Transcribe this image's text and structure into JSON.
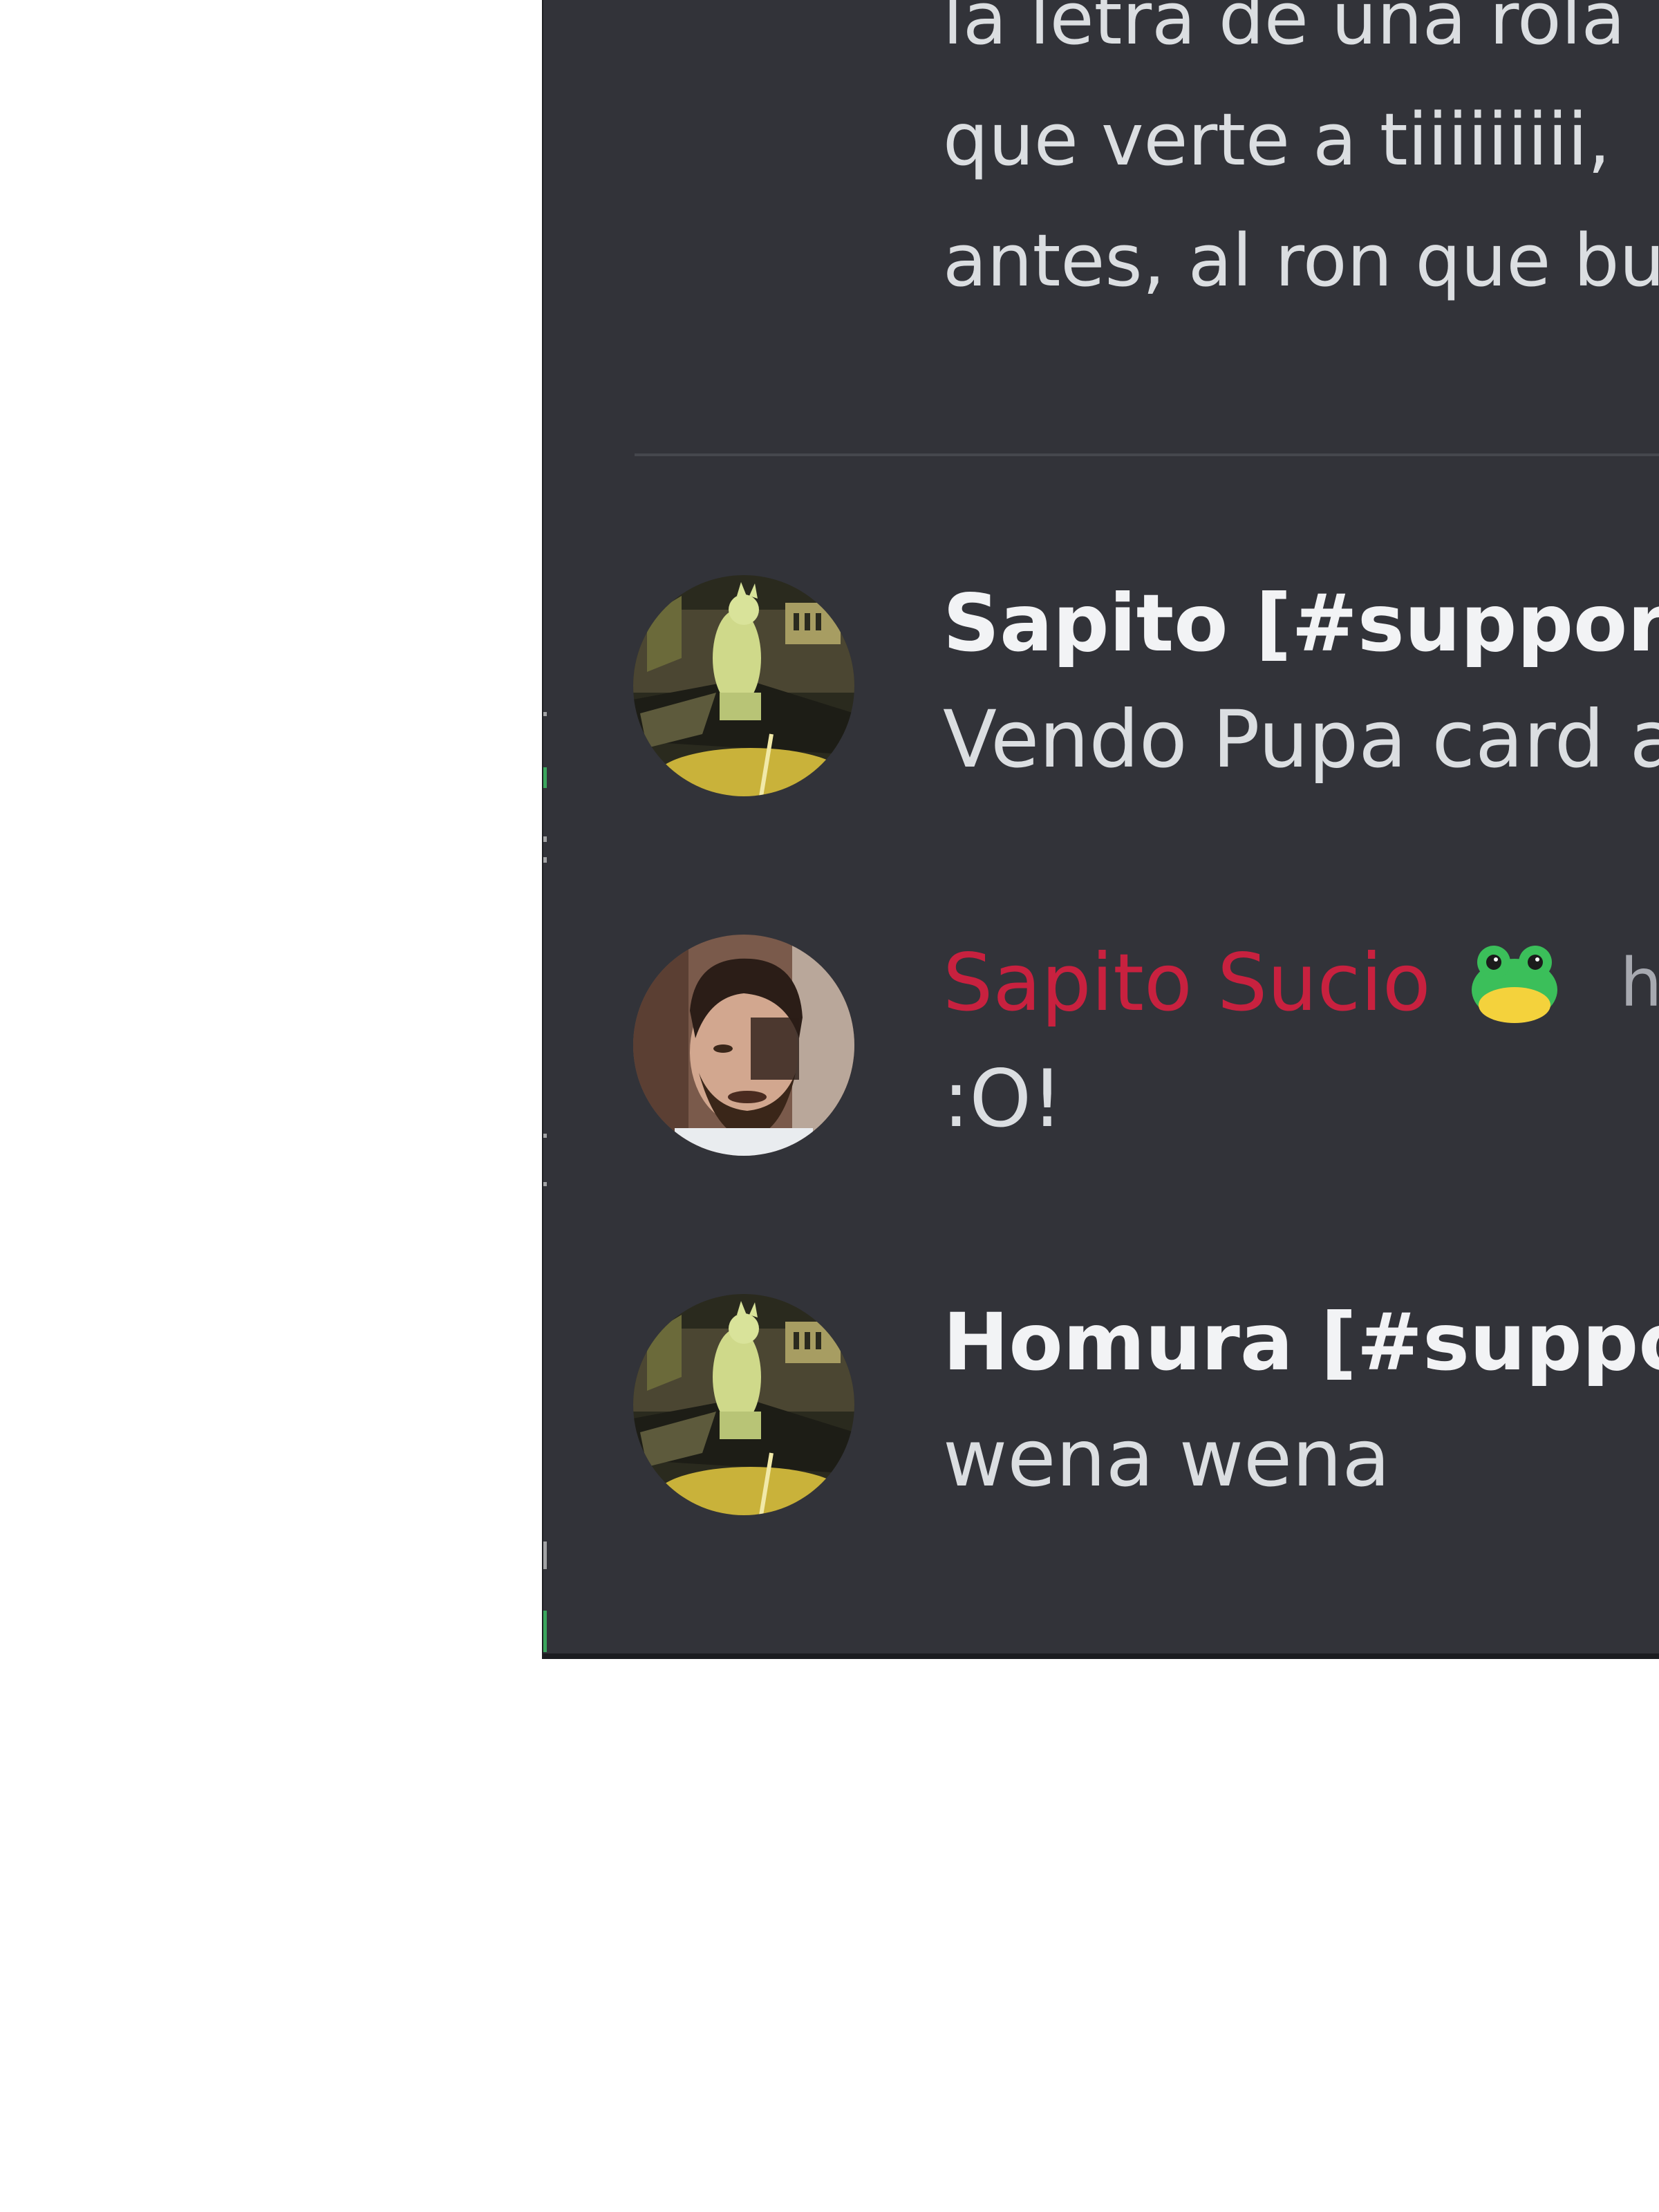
{
  "previous_message": {
    "lines": [
      "la letra de una rola",
      "que verte a tiiiiiiiii,",
      "antes, al ron que bu"
    ]
  },
  "messages": [
    {
      "author": "Sapito [#support]",
      "text": "Vendo Pupa card a",
      "avatar": "cat-statue-avatar",
      "has_role_badge": true
    },
    {
      "author": "Sapito Sucio",
      "author_color": "#c8213f",
      "text": ":O!",
      "avatar": "bearded-man-avatar",
      "emoji": "frog-icon",
      "timestamp": "ho"
    },
    {
      "author": "Homura [#support]",
      "text": "wena wena",
      "avatar": "cat-statue-avatar"
    }
  ],
  "colors": {
    "panel_background": "#323339",
    "text_primary": "#dbdee1",
    "author_name": "#f2f3f5",
    "role_badge": "#5865f2",
    "timestamp": "#a7a9b0"
  }
}
